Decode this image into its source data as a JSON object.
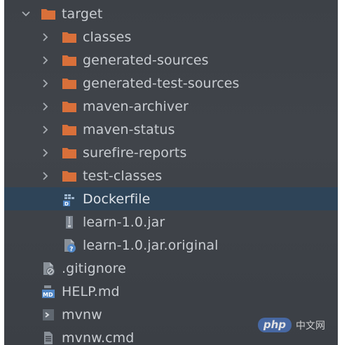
{
  "tree": {
    "target": {
      "label": "target",
      "icon": "folder-orange-icon",
      "expanded": true
    },
    "children": [
      {
        "label": "classes",
        "icon": "folder-orange-icon"
      },
      {
        "label": "generated-sources",
        "icon": "folder-orange-icon"
      },
      {
        "label": "generated-test-sources",
        "icon": "folder-orange-icon"
      },
      {
        "label": "maven-archiver",
        "icon": "folder-orange-icon"
      },
      {
        "label": "maven-status",
        "icon": "folder-orange-icon"
      },
      {
        "label": "surefire-reports",
        "icon": "folder-orange-icon"
      },
      {
        "label": "test-classes",
        "icon": "folder-orange-icon"
      },
      {
        "label": "Dockerfile",
        "icon": "dockerfile-icon",
        "selected": true
      },
      {
        "label": "learn-1.0.jar",
        "icon": "jar-archive-icon"
      },
      {
        "label": "learn-1.0.jar.original",
        "icon": "unknown-file-icon"
      }
    ],
    "root_files": [
      {
        "label": ".gitignore",
        "icon": "gitignore-icon"
      },
      {
        "label": "HELP.md",
        "icon": "markdown-file-icon"
      },
      {
        "label": "mvnw",
        "icon": "shell-script-icon"
      },
      {
        "label": "mvnw.cmd",
        "icon": "text-file-icon"
      }
    ]
  },
  "colors": {
    "folder": "#d9703a",
    "selection": "#2e4458",
    "text": "#c9cdd2"
  },
  "watermark": {
    "badge": "php",
    "text": "中文网"
  }
}
